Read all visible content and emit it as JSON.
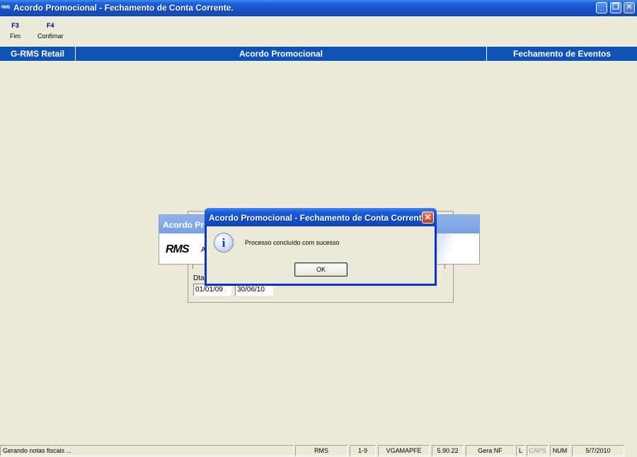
{
  "window": {
    "icon_text": "RMS",
    "title": "Acordo Promocional - Fechamento de Conta Corrente.",
    "min_glyph": "_",
    "restore_glyph": "❐",
    "close_glyph": "✕"
  },
  "toolbar": {
    "items": [
      {
        "key": "F3",
        "label": "Fim"
      },
      {
        "key": "F4",
        "label": "Confimar"
      }
    ]
  },
  "header_band": {
    "left": "G-RMS Retail",
    "center": "Acordo Promocional",
    "right": "Fechamento de Eventos"
  },
  "background_window": {
    "title": "Acordo Pro",
    "logo": "RMS",
    "subtitle": "A",
    "date_label": "Dta",
    "date_from": "01/01/09",
    "date_to": "30/06/10"
  },
  "dialog": {
    "title": "Acordo Promocional - Fechamento de Conta Corrente.",
    "close_glyph": "✕",
    "icon_glyph": "i",
    "message": "Processo concluído com sucesso",
    "ok_label": "OK"
  },
  "statusbar": {
    "message": "Gerando notas fiscais ...",
    "system": "RMS",
    "range": "1-9",
    "program": "VGAMAPFE",
    "version": "5.90.22",
    "mode": "Gera NF",
    "l": "L",
    "caps": "CAPS",
    "num": "NUM",
    "date": "5/7/2010"
  }
}
